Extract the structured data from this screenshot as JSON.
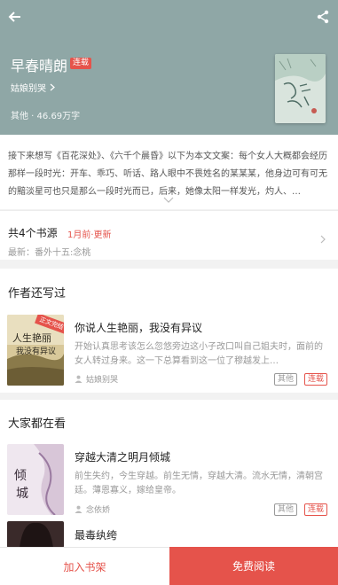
{
  "header": {
    "title": "早春晴朗",
    "status_badge": "连载",
    "author": "姑娘别哭",
    "meta": "其他 · 46.69万字",
    "bg_color": "#8fa7a6"
  },
  "synopsis": {
    "text": "接下来想写《百花深处》、《六千个晨昏》以下为本文文案：每个女人大概都会经历那样一段时光：开车、乖巧、听话、路人眼中不畏姓名的某某某，他身边可有可无的黯淡星可也只是那么一段时光而已，后来，她像太阳一样发光，灼人、…"
  },
  "sources": {
    "title": "共4个书源",
    "update": "1月前·更新",
    "latest": "最新：番外十五:念桃"
  },
  "author_books": {
    "section_title": "作者还写过",
    "items": [
      {
        "title": "你说人生艳丽，我没有异议",
        "desc": "开始认真思考该怎么忽悠旁边这小子改口叫自己姐夫时，面前的女人转过身来。这一下总算看到这一位了穆越发上…",
        "author": "姑娘别哭",
        "tag_genre": "其他",
        "tag_status": "连载",
        "cover_ribbon": "正文完结",
        "cover_text": "人生艳丽我没有异议"
      }
    ]
  },
  "popular": {
    "section_title": "大家都在看",
    "items": [
      {
        "title": "穿越大清之明月倾城",
        "desc": "前生失约，今生穿越。前生无情，穿越大清。流水无情，清朝宫廷。薄恩寡义，嫁给皇帝。",
        "author": "念依娇",
        "tag_genre": "其他",
        "tag_status": "连载",
        "cover_text": "倾城"
      },
      {
        "title": "最毒纨绔"
      }
    ]
  },
  "bottom": {
    "add_shelf": "加入书架",
    "read_free": "免费阅读"
  },
  "colors": {
    "accent": "#e5534b"
  }
}
